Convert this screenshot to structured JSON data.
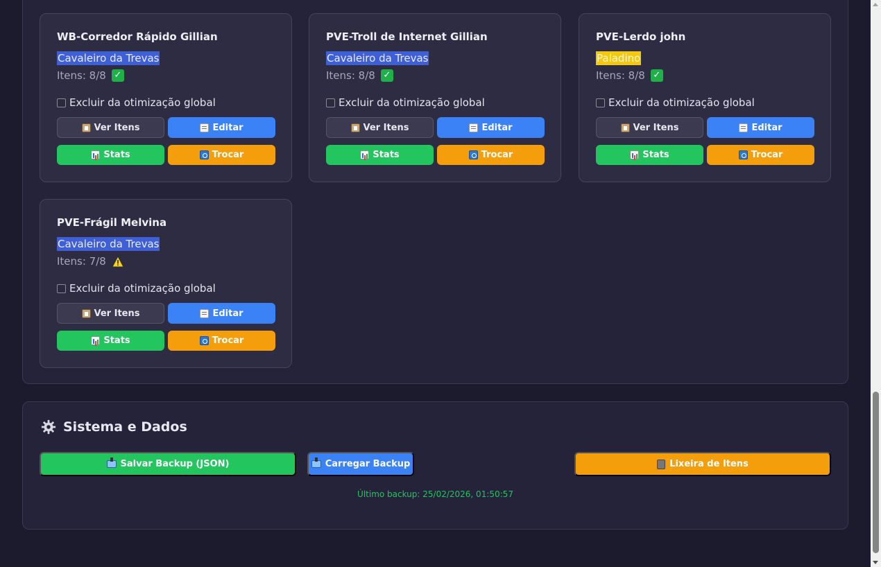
{
  "characters": [
    {
      "name": "WB-Corredor Rápido Gillian",
      "class": "Cavaleiro da Trevas",
      "items": "Itens: 8/8",
      "status": "check",
      "exclude_label": "Excluir da otimização global",
      "buttons": {
        "view": "Ver Itens",
        "edit": "Editar",
        "stats": "Stats",
        "swap": "Trocar"
      }
    },
    {
      "name": "PVE-Troll de Internet Gillian",
      "class": "Cavaleiro da Trevas",
      "items": "Itens: 8/8",
      "status": "check",
      "exclude_label": "Excluir da otimização global",
      "buttons": {
        "view": "Ver Itens",
        "edit": "Editar",
        "stats": "Stats",
        "swap": "Trocar"
      }
    },
    {
      "name": "PVE-Lerdo john",
      "class": "Paladino",
      "items": "Itens: 8/8",
      "status": "check",
      "exclude_label": "Excluir da otimização global",
      "buttons": {
        "view": "Ver Itens",
        "edit": "Editar",
        "stats": "Stats",
        "swap": "Trocar"
      }
    },
    {
      "name": "PVE-Frágil Melvina",
      "class": "Cavaleiro da Trevas",
      "items": "Itens: 7/8",
      "status": "warning",
      "exclude_label": "Excluir da otimização global",
      "buttons": {
        "view": "Ver Itens",
        "edit": "Editar",
        "stats": "Stats",
        "swap": "Trocar"
      }
    }
  ],
  "system": {
    "title": "Sistema e Dados",
    "save_backup": "Salvar Backup (JSON)",
    "load_backup": "Carregar Backup",
    "trash": "Lixeira de Itens",
    "last_backup": "Último backup: 25/02/2026, 01:50:57"
  },
  "colors": {
    "background": "#1c1b2e",
    "panel": "#24233a",
    "card": "#2d2c42",
    "edit_blue": "#3b82f6",
    "stats_green": "#22c55e",
    "swap_orange": "#f59e0b",
    "dark_knight_highlight": "#3f5fd6",
    "paladin_highlight": "#f2c811"
  },
  "icons": {
    "view_items": "clipboard-icon",
    "edit": "memo-icon",
    "stats": "bar-chart-icon",
    "swap": "swap-arrows-icon",
    "complete": "check-mark-icon",
    "incomplete": "warning-icon",
    "system": "gear-icon",
    "backup": "outbox-tray-icon",
    "trash": "wastebasket-icon"
  }
}
